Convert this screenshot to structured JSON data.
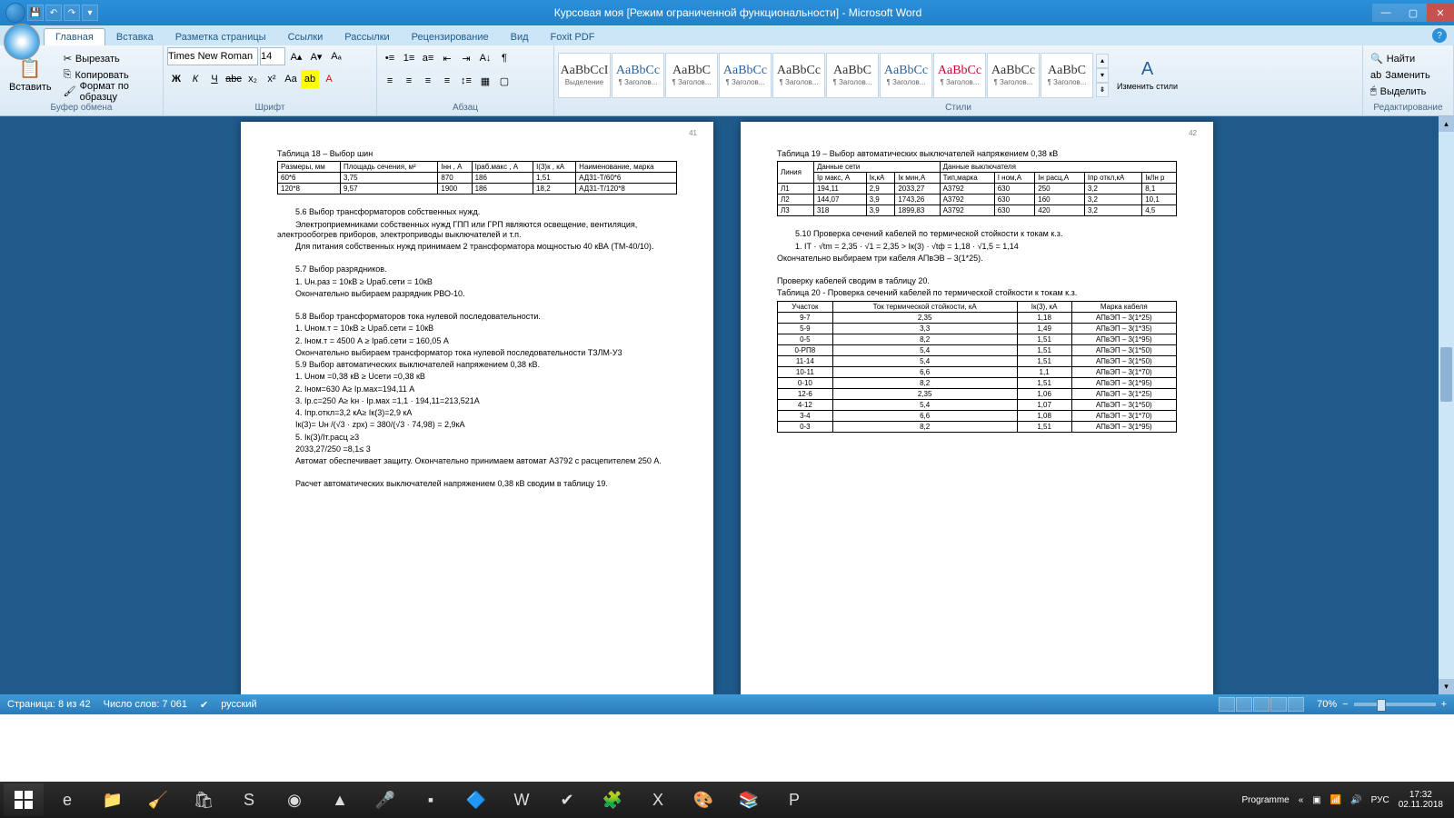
{
  "window": {
    "title": "Курсовая моя [Режим ограниченной функциональности] - Microsoft Word"
  },
  "tabs": {
    "items": [
      "Главная",
      "Вставка",
      "Разметка страницы",
      "Ссылки",
      "Рассылки",
      "Рецензирование",
      "Вид",
      "Foxit PDF"
    ],
    "active": 0
  },
  "clipboard": {
    "paste": "Вставить",
    "cut": "Вырезать",
    "copy": "Копировать",
    "format": "Формат по образцу",
    "group": "Буфер обмена"
  },
  "font": {
    "name": "Times New Roman",
    "size": "14",
    "group": "Шрифт"
  },
  "para": {
    "group": "Абзац"
  },
  "styles": {
    "group": "Стили",
    "change": "Изменить стили",
    "items": [
      {
        "prev": "AaBbCcI",
        "name": "Выделение",
        "cls": ""
      },
      {
        "prev": "AaBbCc",
        "name": "¶ Заголов...",
        "cls": "blue"
      },
      {
        "prev": "AaBbC",
        "name": "¶ Заголов...",
        "cls": ""
      },
      {
        "prev": "AaBbCc",
        "name": "¶ Заголов...",
        "cls": "blue"
      },
      {
        "prev": "AaBbCc",
        "name": "¶ Заголов...",
        "cls": ""
      },
      {
        "prev": "AaBbC",
        "name": "¶ Заголов...",
        "cls": ""
      },
      {
        "prev": "AaBbCc",
        "name": "¶ Заголов...",
        "cls": "blue"
      },
      {
        "prev": "AaBbCc",
        "name": "¶ Заголов...",
        "cls": "red"
      },
      {
        "prev": "AaBbCc",
        "name": "¶ Заголов...",
        "cls": ""
      },
      {
        "prev": "AaBbC",
        "name": "¶ Заголов...",
        "cls": ""
      }
    ]
  },
  "editing": {
    "find": "Найти",
    "replace": "Заменить",
    "select": "Выделить",
    "group": "Редактирование"
  },
  "status": {
    "page": "Страница: 8 из 42",
    "words": "Число слов: 7 061",
    "lang": "русский",
    "zoom": "70%"
  },
  "taskbar": {
    "programme": "Programme",
    "lang": "РУС",
    "time": "17:32",
    "date": "02.11.2018"
  },
  "pages": {
    "left": {
      "num": "41",
      "t18_title": "Таблица 18 – Выбор шин",
      "t18_head": [
        "Размеры, мм",
        "Площадь сечения, м²",
        "Iнн , А",
        "Iраб.макс , А",
        "I(3)к , кА",
        "Наименование, марка"
      ],
      "t18_rows": [
        [
          "60*6",
          "3,75",
          "870",
          "186",
          "1,51",
          "АД31-Т/60*6"
        ],
        [
          "120*8",
          "9,57",
          "1900",
          "186",
          "18,2",
          "АД31-Т/120*8"
        ]
      ],
      "p56a": "5.6 Выбор трансформаторов собственных нужд.",
      "p56b": "Электроприемниками собственных нужд ГПП или ГРП являются освещение, вентиляция, электрообогрев приборов, электроприводы выключателей и т.п.",
      "p56c": "Для питания собственных нужд принимаем 2 трансформатора мощностью 40 кВА (ТМ-40/10).",
      "p57a": "5.7 Выбор разрядников.",
      "p57b": "1. Uн.раз = 10кВ ≥ Uраб.сети = 10кВ",
      "p57c": "Окончательно выбираем разрядник РВО-10.",
      "p58a": "5.8 Выбор трансформаторов тока нулевой последовательности.",
      "p58b": "1. Uном.т = 10кВ ≥ Uраб.сети = 10кВ",
      "p58c": "2. Iном.т = 4500 А ≥ Iраб.сети = 160,05 А",
      "p58d": "Окончательно выбираем трансформатор тока нулевой последовательности ТЗЛМ-У3",
      "p59a": "5.9 Выбор автоматических выключателей напряжением 0,38 кВ.",
      "p59b": "1. Uном =0,38 кВ ≥ Uсети =0,38 кВ",
      "p59c": "2. Iном=630 А≥ Iр.мах=194,11 А",
      "p59d": "3. Iр.с=250 А≥ kн · Iр.мах =1,1 · 194,11=213,521А",
      "p59e": "4. Iпр.откл=3,2 кА≥ Iк(3)=2,9 кА",
      "p59f": "Iк(3)= Uн /(√3 · zрх) = 380/(√3 · 74,98) = 2,9кА",
      "p59g": "5. Iк(3)/Iт.расц ≥3",
      "p59h": "2033,27/250 =8,1≤ 3",
      "p59i": "Автомат обеспечивает защиту. Окончательно принимаем автомат А3792 с расцепителем 250 А.",
      "p59j": "Расчет автоматических выключателей напряжением 0,38 кВ сводим в таблицу 19."
    },
    "right": {
      "num": "42",
      "t19_title": "Таблица 19 – Выбор автоматических выключателей напряжением 0,38 кВ",
      "t19_h1": [
        "Линия",
        "Данные сети",
        "Данные выключателя"
      ],
      "t19_h2": [
        "",
        "Iр макс, А",
        "Iк,кА",
        "Iк мин,А",
        "Тип,марка",
        "I ном,А",
        "Iн расц,А",
        "Iпр откл,кА",
        "Iк/Iн р"
      ],
      "t19_rows": [
        [
          "Л1",
          "194,11",
          "2,9",
          "2033,27",
          "А3792",
          "630",
          "250",
          "3,2",
          "8,1"
        ],
        [
          "Л2",
          "144,07",
          "3,9",
          "1743,26",
          "А3792",
          "630",
          "160",
          "3,2",
          "10,1"
        ],
        [
          "Л3",
          "318",
          "3,9",
          "1899,83",
          "А3792",
          "630",
          "420",
          "3,2",
          "4,5"
        ]
      ],
      "p510a": "5.10 Проверка сечений кабелей по термической стойкости к токам к.з.",
      "p510b": "1. IT · √tm = 2,35 · √1 = 2,35 > Iк(3) · √tф = 1,18 · √1,5 = 1,14",
      "p510c": "Окончательно выбираем три кабеля АПвЭВ – 3(1*25).",
      "p510d": "Проверку кабелей сводим в таблицу 20.",
      "t20_title": "Таблица 20 - Проверка сечений кабелей по термической стойкости к токам к.з.",
      "t20_head": [
        "Участок",
        "Ток термической стойкости, кА",
        "Iк(3), кА",
        "Марка кабеля"
      ],
      "t20_rows": [
        [
          "9-7",
          "2,35",
          "1,18",
          "АПвЭП – 3(1*25)"
        ],
        [
          "5-9",
          "3,3",
          "1,49",
          "АПвЭП – 3(1*35)"
        ],
        [
          "0-5",
          "8,2",
          "1,51",
          "АПвЭП – 3(1*95)"
        ],
        [
          "0-РП8",
          "5,4",
          "1,51",
          "АПвЭП – 3(1*50)"
        ],
        [
          "11-14",
          "5,4",
          "1,51",
          "АПвЭП – 3(1*50)"
        ],
        [
          "10-11",
          "6,6",
          "1,1",
          "АПвЭП – 3(1*70)"
        ],
        [
          "0-10",
          "8,2",
          "1,51",
          "АПвЭП – 3(1*95)"
        ],
        [
          "12-6",
          "2,35",
          "1,06",
          "АПвЭП – 3(1*25)"
        ],
        [
          "4-12",
          "5,4",
          "1,07",
          "АПвЭП – 3(1*50)"
        ],
        [
          "3-4",
          "6,6",
          "1,08",
          "АПвЭП – 3(1*70)"
        ],
        [
          "0-3",
          "8,2",
          "1,51",
          "АПвЭП – 3(1*95)"
        ]
      ]
    }
  }
}
